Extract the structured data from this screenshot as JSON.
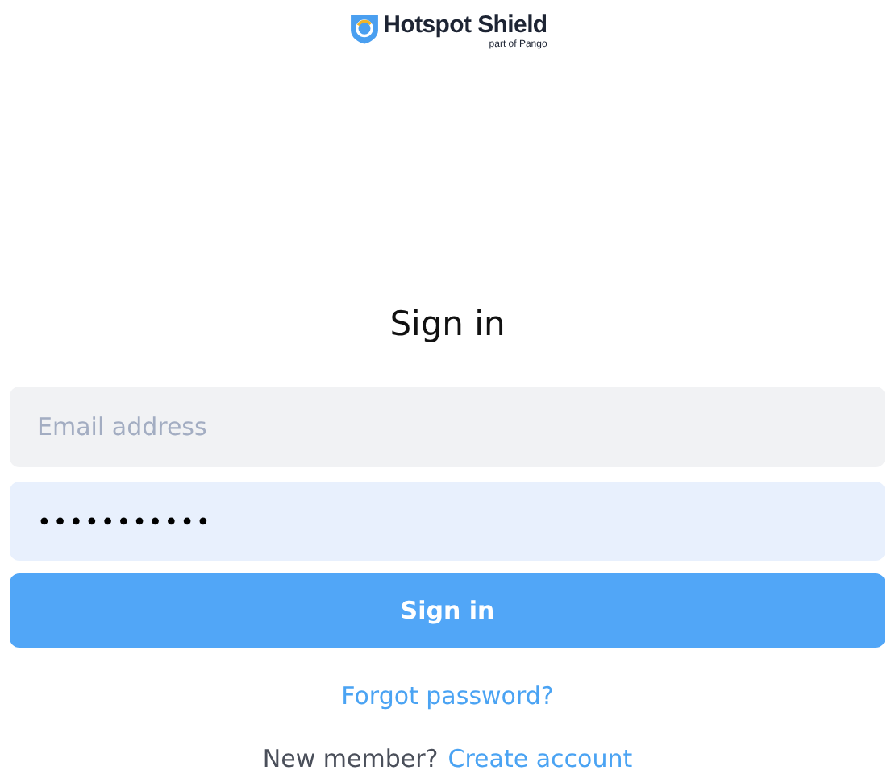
{
  "logo": {
    "name": "Hotspot Shield",
    "tagline": "part of Pango"
  },
  "heading": "Sign in",
  "email": {
    "placeholder": "Email address"
  },
  "password": {
    "value": "•••••••••••"
  },
  "submit": "Sign in",
  "forgot_link": "Forgot password?",
  "signup": {
    "prompt": "New member?",
    "link": "Create account"
  }
}
